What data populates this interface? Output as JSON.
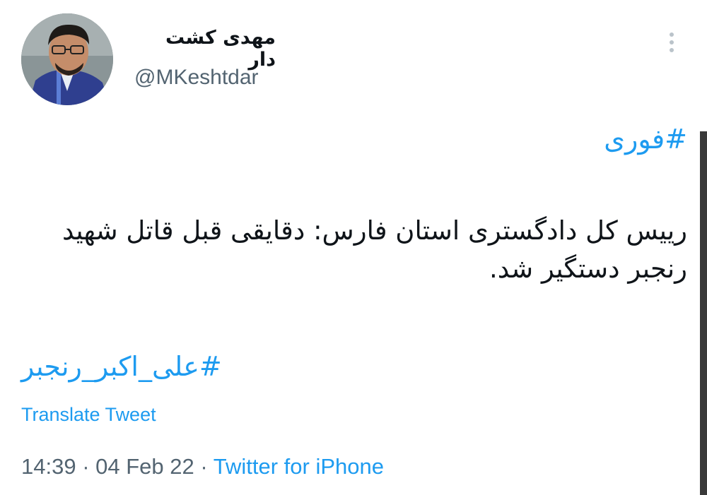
{
  "author": {
    "display_name": "مهدی کشت دار",
    "handle": "@MKeshtdar"
  },
  "tweet": {
    "hashtag_top": "#فوری",
    "text": "رییس کل دادگستری استان فارس: دقایقی قبل قاتل شهید رنجبر دستگیر شد.",
    "hashtag_bottom": "#علی_اکبر_رنجبر",
    "translate_label": "Translate Tweet",
    "time": "14:39",
    "date": "04 Feb 22",
    "separator": "·",
    "source": "Twitter for iPhone"
  },
  "icons": {
    "more": "more-vertical-icon"
  },
  "colors": {
    "link": "#1d9bf0",
    "secondary_text": "#536471",
    "primary_text": "#0f1419"
  }
}
